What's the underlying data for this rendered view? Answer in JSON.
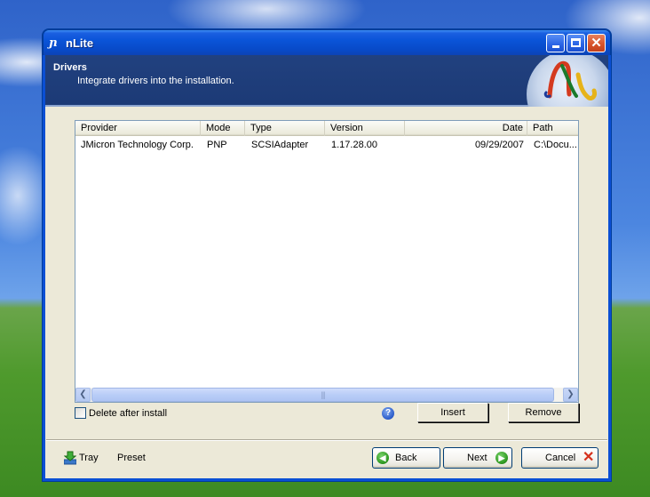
{
  "window": {
    "title": "nLite",
    "app_icon": "nlite-logo-icon"
  },
  "header": {
    "title": "Drivers",
    "subtitle": "Integrate drivers into the installation."
  },
  "list": {
    "columns": [
      "Provider",
      "Mode",
      "Type",
      "Version",
      "Date",
      "Path"
    ],
    "rows": [
      {
        "provider": "JMicron Technology Corp.",
        "mode": "PNP",
        "type": "SCSIAdapter",
        "version": "1.17.28.00",
        "date": "09/29/2007",
        "path": "C:\\Docu..."
      }
    ],
    "scroll_thumb_grip": "|||"
  },
  "options": {
    "delete_after_install": "Delete after install",
    "delete_after_install_checked": false
  },
  "buttons": {
    "help": "?",
    "insert": "Insert",
    "remove": "Remove",
    "tray": "Tray",
    "preset": "Preset",
    "back": "Back",
    "next": "Next",
    "cancel": "Cancel"
  },
  "colors": {
    "header_bg": "#1c3a76",
    "titlebar": "#0a54d8",
    "window_bg": "#ece9d8"
  }
}
